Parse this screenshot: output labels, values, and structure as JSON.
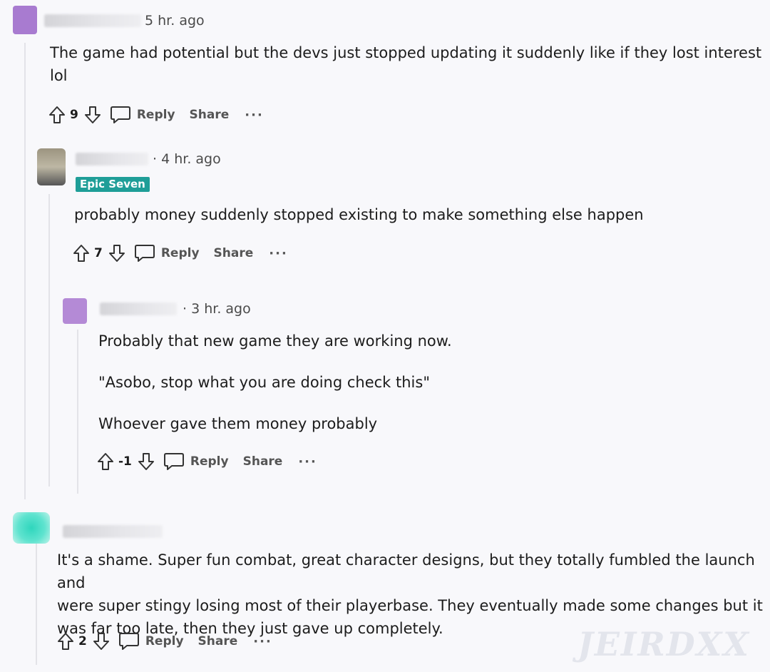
{
  "comments": [
    {
      "time": "5 hr. ago",
      "body": [
        "The game had potential but the devs just stopped updating it suddenly like if they lost interest",
        "lol"
      ],
      "score": "9",
      "reply_label": "Reply",
      "share_label": "Share",
      "more_label": "···",
      "avatar_color": "#a87bd0"
    },
    {
      "time": "· 4 hr. ago",
      "flair": "Epic Seven",
      "body": [
        "probably money suddenly stopped existing to make something else happen"
      ],
      "score": "7",
      "reply_label": "Reply",
      "share_label": "Share",
      "more_label": "···",
      "avatar_color": "#8a8a7a"
    },
    {
      "time": "· 3 hr. ago",
      "body": [
        "Probably that new game they are working now.",
        "\"Asobo, stop what you are doing check this\"",
        "Whoever gave them money probably"
      ],
      "score": "-1",
      "reply_label": "Reply",
      "share_label": "Share",
      "more_label": "···",
      "avatar_color": "#b48ad6"
    },
    {
      "time": "",
      "body": [
        "It's a shame. Super fun combat, great character designs, but they totally fumbled the launch and",
        "were super stingy losing most of their playerbase. They eventually made some changes but it",
        "was far too late, then they just gave up completely."
      ],
      "score": "2",
      "reply_label": "Reply",
      "share_label": "Share",
      "more_label": "···",
      "avatar_color": "#40d9c3"
    }
  ],
  "icons": {
    "upvote": "arrow-up-icon",
    "downvote": "arrow-down-icon",
    "reply": "speech-bubble-icon",
    "more": "ellipsis-icon"
  },
  "watermark": "JEIRDXX"
}
